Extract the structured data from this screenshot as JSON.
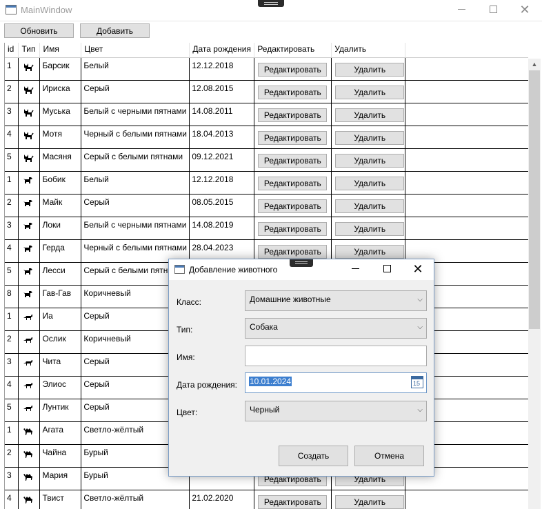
{
  "window": {
    "title": "MainWindow"
  },
  "toolbar": {
    "refresh_label": "Обновить",
    "add_label": "Добавить"
  },
  "grid": {
    "columns": [
      "id",
      "Тип",
      "Имя",
      "Цвет",
      "Дата рождения",
      "Редактировать",
      "Удалить"
    ],
    "edit_label": "Редактировать",
    "delete_label": "Удалить",
    "rows": [
      {
        "id": "1",
        "type_icon": "cat-icon",
        "name": "Барсик",
        "color": "Белый",
        "birth": "12.12.2018"
      },
      {
        "id": "2",
        "type_icon": "cat-icon",
        "name": "Ириска",
        "color": "Серый",
        "birth": "12.08.2015"
      },
      {
        "id": "3",
        "type_icon": "cat-icon",
        "name": "Муська",
        "color": "Белый с черными пятнами",
        "birth": "14.08.2011"
      },
      {
        "id": "4",
        "type_icon": "cat-icon",
        "name": "Мотя",
        "color": "Черный с белыми пятнами",
        "birth": "18.04.2013"
      },
      {
        "id": "5",
        "type_icon": "cat-icon",
        "name": "Масяня",
        "color": "Серый с белыми пятнами",
        "birth": "09.12.2021"
      },
      {
        "id": "1",
        "type_icon": "dog-icon",
        "name": "Бобик",
        "color": "Белый",
        "birth": "12.12.2018"
      },
      {
        "id": "2",
        "type_icon": "dog-icon",
        "name": "Майк",
        "color": "Серый",
        "birth": "08.05.2015"
      },
      {
        "id": "3",
        "type_icon": "dog-icon",
        "name": "Локи",
        "color": "Белый с черными пятнами",
        "birth": "14.08.2019"
      },
      {
        "id": "4",
        "type_icon": "dog-icon",
        "name": "Герда",
        "color": "Черный с белыми пятнами",
        "birth": "28.04.2023"
      },
      {
        "id": "5",
        "type_icon": "dog-icon",
        "name": "Лесси",
        "color": "Серый с белыми пятнами",
        "birth": ""
      },
      {
        "id": "8",
        "type_icon": "dog-icon",
        "name": "Гав-Гав",
        "color": "Коричневый",
        "birth": ""
      },
      {
        "id": "1",
        "type_icon": "donkey-icon",
        "name": "Иа",
        "color": "Серый",
        "birth": ""
      },
      {
        "id": "2",
        "type_icon": "donkey-icon",
        "name": "Ослик",
        "color": "Коричневый",
        "birth": ""
      },
      {
        "id": "3",
        "type_icon": "donkey-icon",
        "name": "Чита",
        "color": "Серый",
        "birth": ""
      },
      {
        "id": "4",
        "type_icon": "donkey-icon",
        "name": "Элиос",
        "color": "Серый",
        "birth": ""
      },
      {
        "id": "5",
        "type_icon": "donkey-icon",
        "name": "Лунтик",
        "color": "Серый",
        "birth": ""
      },
      {
        "id": "1",
        "type_icon": "camel-icon",
        "name": "Агата",
        "color": "Светло-жёлтый",
        "birth": ""
      },
      {
        "id": "2",
        "type_icon": "camel-icon",
        "name": "Чайна",
        "color": "Бурый",
        "birth": ""
      },
      {
        "id": "3",
        "type_icon": "camel-icon",
        "name": "Мария",
        "color": "Бурый",
        "birth": ""
      },
      {
        "id": "4",
        "type_icon": "camel-icon",
        "name": "Твист",
        "color": "Светло-жёлтый",
        "birth": "21.02.2020"
      }
    ]
  },
  "dialog": {
    "title": "Добавление животного",
    "class_label": "Класс:",
    "class_value": "Домашние животные",
    "type_label": "Тип:",
    "type_value": "Собака",
    "name_label": "Имя:",
    "name_value": "",
    "birth_label": "Дата рождения:",
    "birth_value": "10.01.2024",
    "calendar_day": "15",
    "color_label": "Цвет:",
    "color_value": "Черный",
    "create_label": "Создать",
    "cancel_label": "Отмена"
  }
}
